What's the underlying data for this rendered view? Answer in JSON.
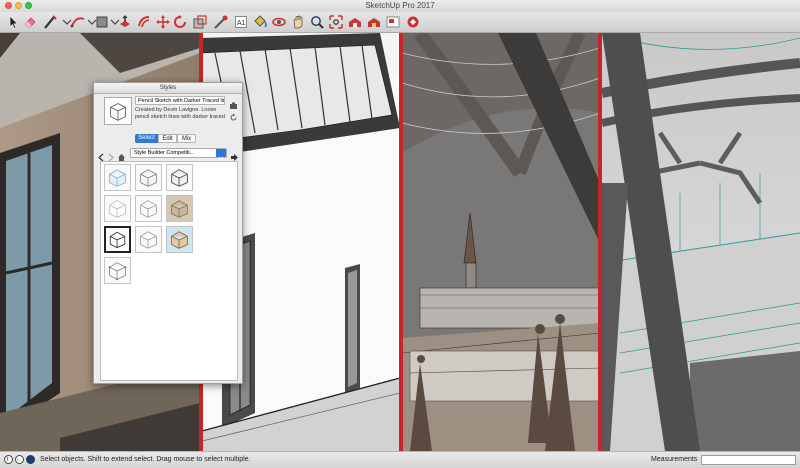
{
  "window": {
    "title": "SketchUp Pro 2017"
  },
  "toolbar": {
    "tools": [
      {
        "name": "select-tool-icon",
        "label": "Select"
      },
      {
        "name": "eraser-tool-icon",
        "label": "Eraser"
      },
      {
        "name": "line-tool-icon",
        "label": "Line"
      },
      {
        "name": "arc-tool-icon",
        "label": "Arc"
      },
      {
        "name": "shape-tool-icon",
        "label": "Shapes"
      },
      {
        "name": "push-pull-tool-icon",
        "label": "Push/Pull"
      },
      {
        "name": "offset-tool-icon",
        "label": "Offset"
      },
      {
        "name": "move-tool-icon",
        "label": "Move"
      },
      {
        "name": "rotate-tool-icon",
        "label": "Rotate"
      },
      {
        "name": "scale-tool-icon",
        "label": "Scale"
      },
      {
        "name": "tape-measure-tool-icon",
        "label": "Tape Measure"
      },
      {
        "name": "text-tool-icon",
        "label": "Text"
      },
      {
        "name": "paint-bucket-tool-icon",
        "label": "Paint Bucket"
      },
      {
        "name": "orbit-tool-icon",
        "label": "Orbit"
      },
      {
        "name": "pan-tool-icon",
        "label": "Pan"
      },
      {
        "name": "zoom-tool-icon",
        "label": "Zoom"
      },
      {
        "name": "zoom-extents-tool-icon",
        "label": "Zoom Extents"
      },
      {
        "name": "warehouse-icon",
        "label": "3D Warehouse"
      },
      {
        "name": "extension-warehouse-icon",
        "label": "Extension Warehouse"
      },
      {
        "name": "layout-icon",
        "label": "Send to LayOut"
      },
      {
        "name": "extension-manager-icon",
        "label": "Extension Manager"
      }
    ]
  },
  "styles_panel": {
    "title": "Styles",
    "style_name": "Pencil Sketch with Darker Traced lines",
    "style_description": "Created by Devin Lavigne.  Loose pencil sketch lines with darker traced",
    "tabs": [
      "Select",
      "Edit",
      "Mix"
    ],
    "active_tab": "Select",
    "collection": "Style Builder Competiti..."
  },
  "status": {
    "message": "Select objects. Shift to extend select. Drag mouse to select multiple.",
    "measurements_label": "Measurements",
    "measurements_value": ""
  },
  "colors": {
    "section_divider": "#c8242b",
    "accent": "#2f78d6",
    "teal_lines": "#2b9c9a"
  }
}
